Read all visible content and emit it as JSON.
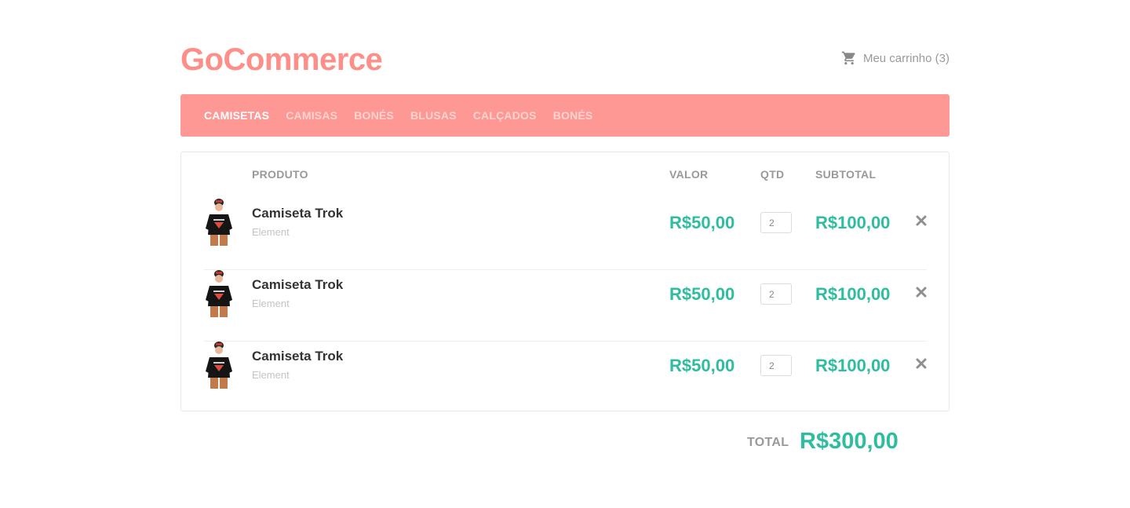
{
  "brand": {
    "name": "GoCommerce",
    "color": "#fd8f88"
  },
  "cart": {
    "label": "Meu carrinho (3)",
    "icon": "shopping-cart-icon"
  },
  "nav": {
    "items": [
      {
        "label": "CAMISETAS",
        "active": true
      },
      {
        "label": "CAMISAS",
        "active": false
      },
      {
        "label": "BONÉS",
        "active": false
      },
      {
        "label": "BLUSAS",
        "active": false
      },
      {
        "label": "CALÇADOS",
        "active": false
      },
      {
        "label": "BONÉS",
        "active": false
      }
    ],
    "background": "#fe9895"
  },
  "table": {
    "headers": {
      "product": "PRODUTO",
      "price": "VALOR",
      "qty": "QTD",
      "subtotal": "SUBTOTAL"
    },
    "rows": [
      {
        "name": "Camiseta Trok",
        "brand": "Element",
        "price": "R$50,00",
        "qty": "2",
        "subtotal": "R$100,00"
      },
      {
        "name": "Camiseta Trok",
        "brand": "Element",
        "price": "R$50,00",
        "qty": "2",
        "subtotal": "R$100,00"
      },
      {
        "name": "Camiseta Trok",
        "brand": "Element",
        "price": "R$50,00",
        "qty": "2",
        "subtotal": "R$100,00"
      }
    ]
  },
  "total": {
    "label": "TOTAL",
    "value": "R$300,00"
  },
  "accent": "#2ebd9f"
}
